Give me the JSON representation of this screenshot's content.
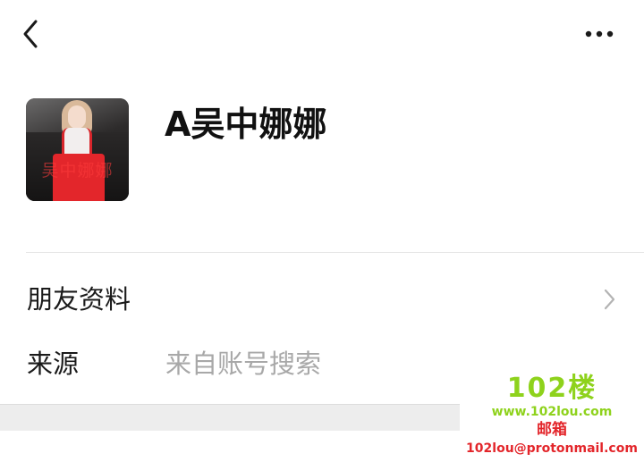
{
  "header": {
    "back_icon": "chevron-left-icon",
    "more_icon": "more-horizontal-icon"
  },
  "profile": {
    "avatar_watermark": "吴中娜娜",
    "name": "A吴中娜娜"
  },
  "rows": {
    "friend_info_label": "朋友资料",
    "friend_info_icon": "chevron-right-icon",
    "source_label": "来源",
    "source_value": "来自账号搜索"
  },
  "watermark": {
    "title": "102楼",
    "site": "www.102lou.com",
    "mail_label": "邮箱",
    "mail": "102lou@protonmail.com"
  },
  "colors": {
    "accent_green": "#8ed21c",
    "accent_red": "#e3262b",
    "muted_text": "#a8a8a8"
  }
}
